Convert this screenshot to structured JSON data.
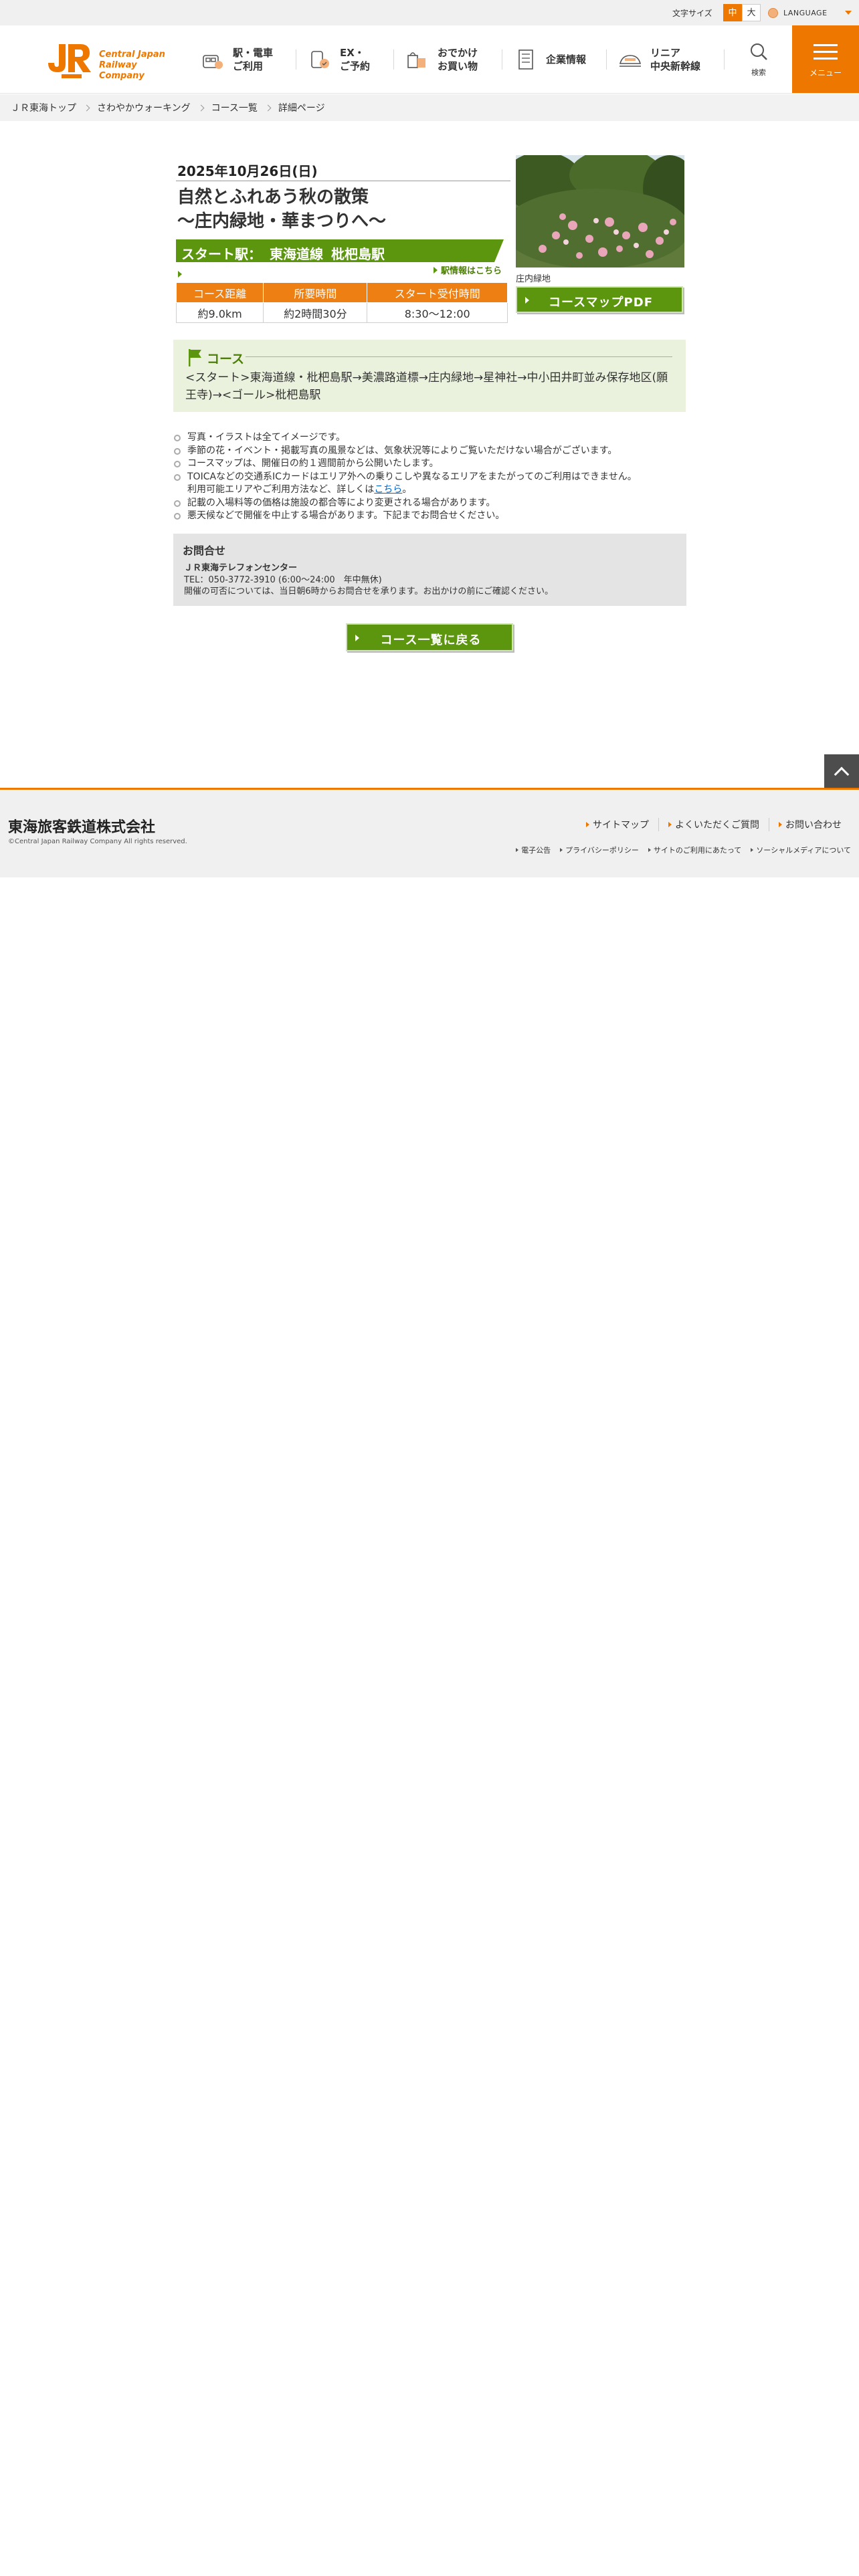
{
  "utility": {
    "font_size_label": "文字サイズ",
    "font_mid": "中",
    "font_large": "大",
    "language": "LANGUAGE"
  },
  "header": {
    "logo_line1": "Central Japan",
    "logo_line2": "Railway Company",
    "nav": [
      {
        "label": "駅・電車\nご利用",
        "icon": "train-station-icon"
      },
      {
        "label": "EX・\nご予約",
        "icon": "ticket-reservation-icon"
      },
      {
        "label": "おでかけ\nお買い物",
        "icon": "shopping-icon"
      },
      {
        "label": "企業情報",
        "icon": "building-icon"
      },
      {
        "label": "リニア\n中央新幹線",
        "icon": "maglev-icon"
      }
    ],
    "search_label": "検索",
    "menu_label": "メニュー"
  },
  "breadcrumb": [
    "ＪＲ東海トップ",
    "さわやかウォーキング",
    "コース一覧",
    "詳細ページ"
  ],
  "event": {
    "date": "2025年10月26日(日)",
    "title": "自然とふれあう秋の散策\n～庄内緑地・華まつりへ～",
    "start_prefix": "スタート駅：",
    "start_line": "東海道線",
    "start_station": "枇杷島駅",
    "station_info_link": "駅情報はこちら",
    "photo_caption": "庄内緑地",
    "map_button": "コースマップPDF"
  },
  "info_table": {
    "headers": [
      "コース距離",
      "所要時間",
      "スタート受付時間"
    ],
    "values": [
      "約9.0km",
      "約2時間30分",
      "8:30～12:00"
    ]
  },
  "course": {
    "heading": "コース",
    "route": "<スタート>東海道線・枇杷島駅→美濃路道標→庄内緑地→星神社→中小田井町並み保存地区(願王寺)→<ゴール>枇杷島駅"
  },
  "notes": [
    {
      "text": "写真・イラストは全てイメージです。",
      "bullet": true
    },
    {
      "text": "季節の花・イベント・掲載写真の風景などは、気象状況等によりご覧いただけない場合がございます。",
      "bullet": true
    },
    {
      "text": "コースマップは、開催日の約１週間前から公開いたします。",
      "bullet": true
    },
    {
      "text": "TOICAなどの交通系ICカードはエリア外への乗りこしや異なるエリアをまたがってのご利用はできません。",
      "bullet": true
    },
    {
      "text": "利用可能エリアやご利用方法など、詳しくは",
      "link": "こちら",
      "after": "。",
      "bullet": false
    },
    {
      "text": "記載の入場料等の価格は施設の都合等により変更される場合があります。",
      "bullet": true
    },
    {
      "text": "悪天候などで開催を中止する場合があります。下記までお問合せください。",
      "bullet": true
    }
  ],
  "contact": {
    "heading": "お問合せ",
    "name": "ＪＲ東海テレフォンセンター",
    "tel": "TEL：050-3772-3910 (6:00～24:00　年中無休)",
    "note": "開催の可否については、当日朝6時からお問合せを承ります。お出かけの前にご確認ください。"
  },
  "back_button": "コース一覧に戻る",
  "footer": {
    "company": "東海旅客鉄道株式会社",
    "copyright": "©Central Japan Railway Company All rights reserved.",
    "links_primary": [
      "サイトマップ",
      "よくいただくご質問",
      "お問い合わせ"
    ],
    "links_secondary": [
      "電子公告",
      "プライバシーポリシー",
      "サイトのご利用にあたって",
      "ソーシャルメディアについて"
    ]
  },
  "colors": {
    "brand_orange": "#ee7700",
    "accent_green": "#5c950e",
    "course_bg": "#eaf2de",
    "contact_bg": "#e4e4e4"
  }
}
